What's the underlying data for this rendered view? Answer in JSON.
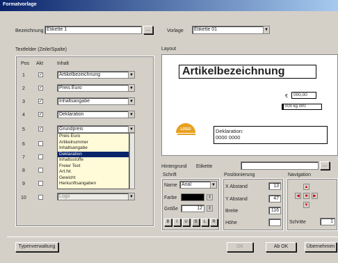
{
  "window": {
    "title": "Formatvorlage"
  },
  "top": {
    "bezeichnung_label": "Bezeichnung",
    "bezeichnung_value": "Etikette 1",
    "vorlage_label": "Vorlage",
    "vorlage_value": "Etikette 01"
  },
  "left": {
    "section_label": "Textfelder (Zeile/Spalte)",
    "columns": {
      "pos": "Pos",
      "akt": "Akt",
      "inhalt": "Inhalt"
    },
    "rows": [
      {
        "pos": "1",
        "checked": true,
        "value": "Artikelbezeichnung"
      },
      {
        "pos": "2",
        "checked": true,
        "value": "Preis Euro"
      },
      {
        "pos": "3",
        "checked": true,
        "value": "Inhaltsangabe"
      },
      {
        "pos": "4",
        "checked": true,
        "value": "Deklaration"
      },
      {
        "pos": "5",
        "checked": true,
        "value": "Grundpreis"
      },
      {
        "pos": "6",
        "checked": false,
        "value": ""
      },
      {
        "pos": "7",
        "checked": false,
        "value": ""
      },
      {
        "pos": "8",
        "checked": false,
        "value": ""
      },
      {
        "pos": "9",
        "checked": false,
        "value": ""
      },
      {
        "pos": "10",
        "checked": false,
        "value": "Logo"
      }
    ],
    "dropdown_options": [
      "Preis Euro",
      "Artikelnummer",
      "Inhaltsangabe",
      "Deklaration",
      "Inhaltsstoffe",
      "Freier Text",
      "Art.Nr.",
      "Gewicht",
      "Herkunftsangaben"
    ],
    "dropdown_selected": "Deklaration"
  },
  "right": {
    "section_label": "Layout",
    "preview": {
      "heading": "Artikelbezeichnung",
      "price_prefix": "€",
      "price_value": "000,00",
      "qty_value": "000 kg 000",
      "decl_label": "Deklaration:",
      "decl_value": "0000 0000",
      "logo_text": "LOGO"
    },
    "zoom_label": "Hintergrund",
    "zoom_value": "Etikette",
    "schrift": {
      "title": "Schrift",
      "name_label": "Name",
      "name_value": "Arial",
      "farbe_label": "Farbe",
      "groesse_label": "Größe",
      "groesse_value": "12",
      "styles": [
        "B",
        "I",
        "U",
        "S",
        "L",
        "R"
      ]
    },
    "position": {
      "title": "Positionierung",
      "x_label": "X Abstand",
      "x_value": "13",
      "y_label": "Y Abstand",
      "y_value": "47",
      "breite_label": "Breite",
      "breite_value": "116",
      "hoehe_label": "Höhe",
      "hoehe_value": ""
    },
    "navigation": {
      "title": "Navigation",
      "schritt_label": "Schritte",
      "schritt_value": "1"
    }
  },
  "buttons": {
    "typenverwaltung": "Typenverwaltung",
    "ok": "OK",
    "abbrechen": "Ab OK",
    "uebernehmen": "Übernehmen"
  },
  "colors": {
    "selection": "#0a246a",
    "logo": "#e8a020",
    "font_color": "#000000"
  }
}
